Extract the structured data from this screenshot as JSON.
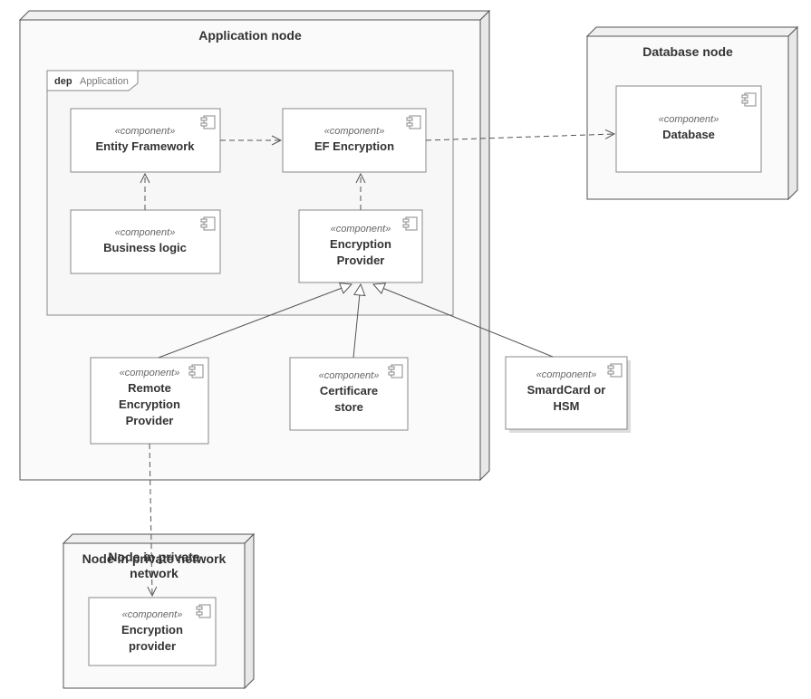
{
  "diagram": {
    "nodes": {
      "app": {
        "title": "Application node"
      },
      "db": {
        "title": "Database node"
      },
      "priv": {
        "title": "Node in private network"
      }
    },
    "package": {
      "app": {
        "tag": "dep",
        "name": "Application"
      }
    },
    "components": {
      "ef": {
        "stereo": "«component»",
        "name": "Entity Framework"
      },
      "efe": {
        "stereo": "«component»",
        "name": "EF Encryption"
      },
      "bl": {
        "stereo": "«component»",
        "name": "Business logic"
      },
      "ep": {
        "stereo": "«component»",
        "name": "Encryption",
        "name2": "Provider"
      },
      "rep": {
        "stereo": "«component»",
        "name": "Remote",
        "name2": "Encryption",
        "name3": "Provider"
      },
      "cs": {
        "stereo": "«component»",
        "name": "Certificare",
        "name2": "store"
      },
      "sc": {
        "stereo": "«component»",
        "name": "SmardCard or",
        "name2": "HSM"
      },
      "dbcomp": {
        "stereo": "«component»",
        "name": "Database"
      },
      "ep2": {
        "stereo": "«component»",
        "name": "Encryption",
        "name2": "provider"
      }
    },
    "connectors": [
      {
        "from": "bl",
        "to": "ef",
        "type": "dependency-dashed"
      },
      {
        "from": "ef",
        "to": "efe",
        "type": "dependency-dashed"
      },
      {
        "from": "ep",
        "to": "efe",
        "type": "dependency-dashed"
      },
      {
        "from": "efe",
        "to": "dbcomp",
        "type": "dependency-dashed"
      },
      {
        "from": "rep",
        "to": "ep",
        "type": "generalization"
      },
      {
        "from": "cs",
        "to": "ep",
        "type": "generalization"
      },
      {
        "from": "sc",
        "to": "ep",
        "type": "generalization"
      },
      {
        "from": "rep",
        "to": "ep2",
        "type": "dependency-dashed"
      }
    ]
  }
}
